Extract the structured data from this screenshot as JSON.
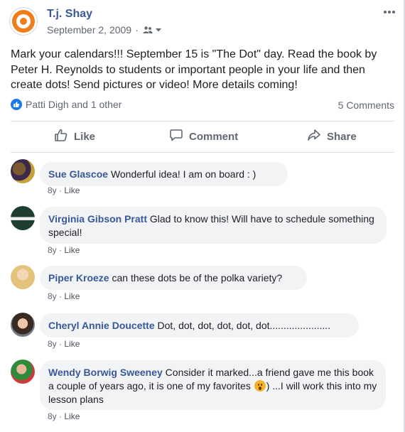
{
  "post": {
    "author": "T.j. Shay",
    "date": "September 2, 2009",
    "separator": "·",
    "text": "Mark your calendars!!! September 15 is \"The Dot\" day. Read the book by Peter H. Reynolds to students or important people in your life and then create dots! Send pictures or video! More details coming!",
    "reactions_text": "Patti Digh and 1 other",
    "comments_count": "5 Comments"
  },
  "actions": {
    "like": "Like",
    "comment": "Comment",
    "share": "Share"
  },
  "comments": [
    {
      "name": "Sue Glascoe",
      "text": "Wonderful idea! I am on board : )",
      "age": "8y",
      "dot": "·",
      "like": "Like"
    },
    {
      "name": "Virginia Gibson Pratt",
      "text": "Glad to know this! Will have to schedule something special!",
      "age": "8y",
      "dot": "·",
      "like": "Like"
    },
    {
      "name": "Piper Kroeze",
      "text": "can these dots be of the polka variety?",
      "age": "8y",
      "dot": "·",
      "like": "Like"
    },
    {
      "name": "Cheryl Annie Doucette",
      "text": "Dot, dot, dot, dot, dot, dot......................",
      "age": "8y",
      "dot": "·",
      "like": "Like"
    },
    {
      "name": "Wendy Borwig Sweeney",
      "text_before": "Consider it marked...a friend gave me this book a couple of years ago, it is one of my favorites",
      "text_after": ") ...I will work this into my lesson plans",
      "age": "8y",
      "dot": "·",
      "like": "Like"
    }
  ],
  "colors": {
    "link": "#385898",
    "accent": "#1877f2",
    "bubble": "#f2f3f5",
    "secondary_text": "#616770"
  },
  "icons": [
    "page-logo-icon",
    "audience-friends-icon",
    "chevron-down-icon",
    "more-options-icon",
    "like-reaction-icon",
    "thumbs-up-icon",
    "comment-icon",
    "share-icon",
    "surprised-emoji-icon"
  ]
}
